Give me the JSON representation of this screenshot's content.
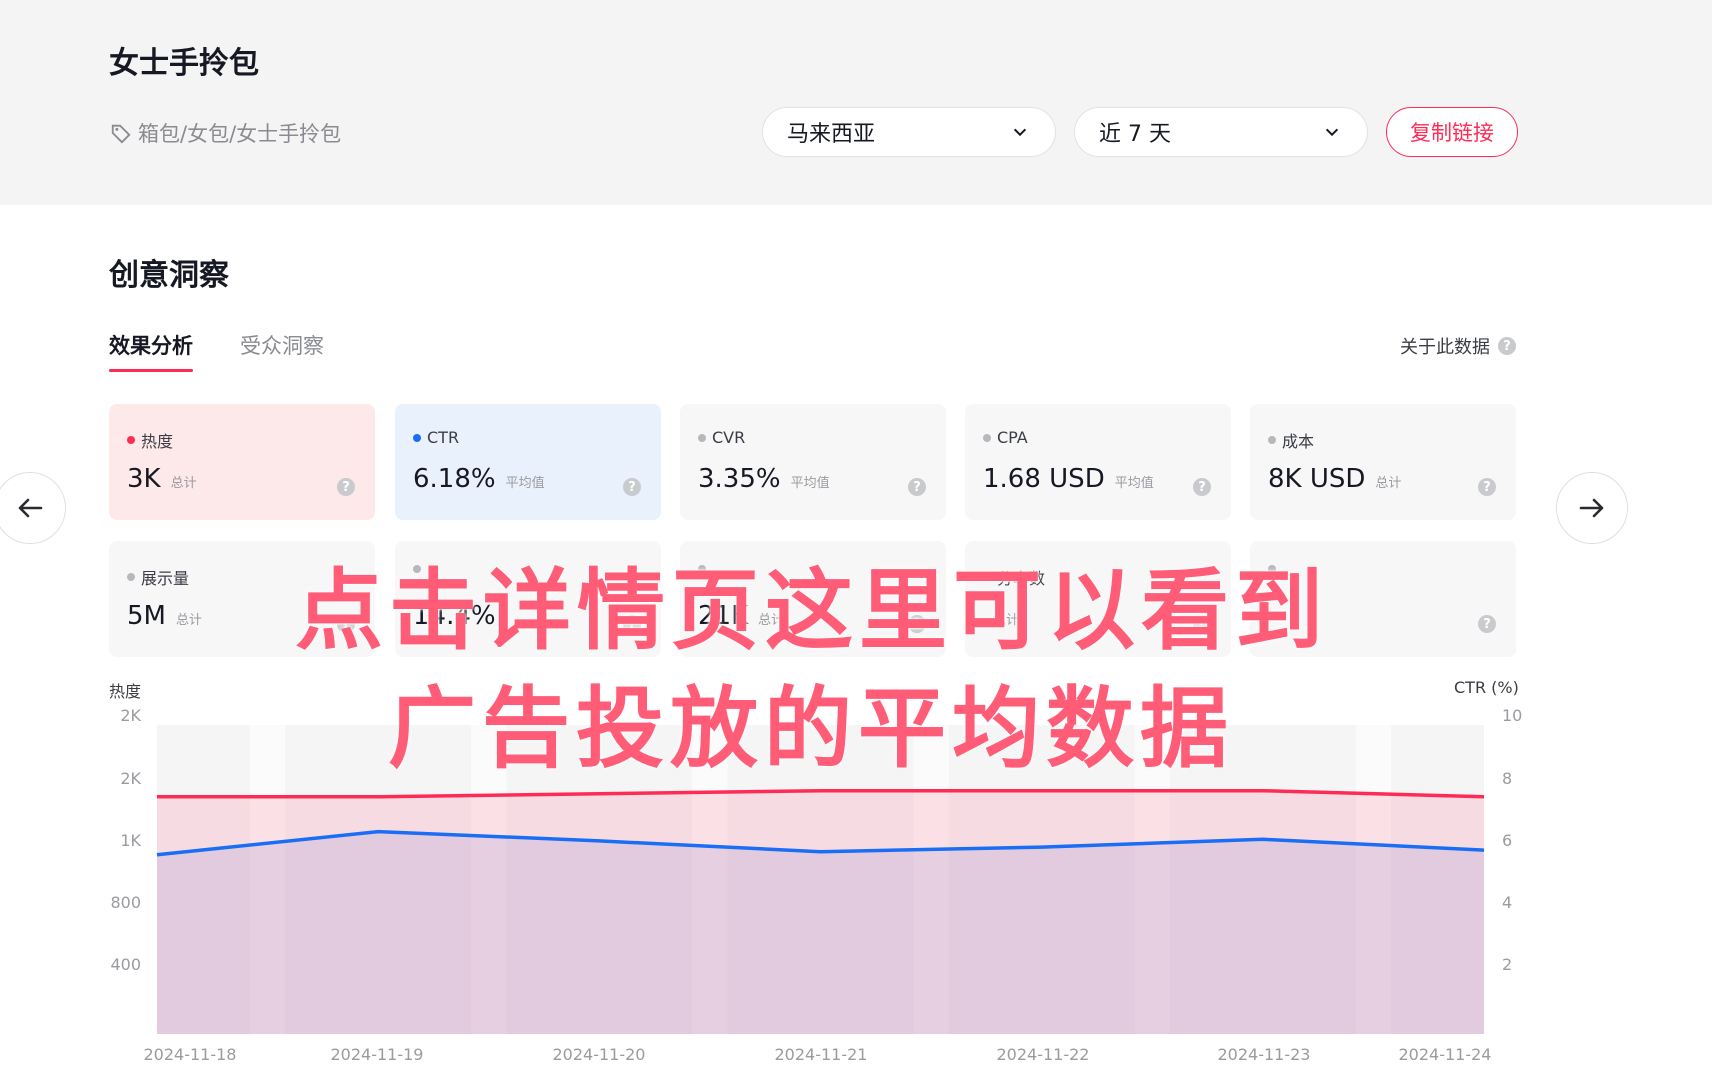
{
  "header": {
    "title": "女士手拎包",
    "breadcrumb": "箱包/女包/女士手拎包",
    "country": "马来西亚",
    "period": "近 7 天",
    "copy_link": "复制链接"
  },
  "section": {
    "title": "创意洞察",
    "tabs": [
      "效果分析",
      "受众洞察"
    ],
    "about": "关于此数据"
  },
  "metrics": [
    {
      "label": "热度",
      "value": "3K",
      "unit": "总计",
      "dot_color": "#fe2c55",
      "selected": "red"
    },
    {
      "label": "CTR",
      "value": "6.18%",
      "unit": "平均值",
      "dot_color": "#1a6ef5",
      "selected": "blue"
    },
    {
      "label": "CVR",
      "value": "3.35%",
      "unit": "平均值",
      "dot_color": "#b7b8bc",
      "selected": ""
    },
    {
      "label": "CPA",
      "value": "1.68 USD",
      "unit": "平均值",
      "dot_color": "#b7b8bc",
      "selected": ""
    },
    {
      "label": "成本",
      "value": "8K USD",
      "unit": "总计",
      "dot_color": "#b7b8bc",
      "selected": ""
    },
    {
      "label": "展示量",
      "value": "5M",
      "unit": "总计",
      "dot_color": "#b7b8bc",
      "selected": ""
    },
    {
      "label": "",
      "value": "14.4%",
      "unit": "",
      "dot_color": "#b7b8bc",
      "selected": ""
    },
    {
      "label": "",
      "value": "21K",
      "unit": "总计",
      "dot_color": "#b7b8bc",
      "selected": ""
    },
    {
      "label": "分享数",
      "value": "",
      "unit": "总计",
      "dot_color": "#b7b8bc",
      "selected": ""
    },
    {
      "label": "",
      "value": "",
      "unit": "",
      "dot_color": "#b7b8bc",
      "selected": ""
    }
  ],
  "chart_data": {
    "type": "area",
    "ylabel_left": "热度",
    "ylabel_right": "CTR (%)",
    "left_ticks": [
      "2K",
      "2K",
      "1K",
      "800",
      "400"
    ],
    "right_ticks": [
      "10",
      "8",
      "6",
      "4",
      "2"
    ],
    "x": [
      "2024-11-18",
      "2024-11-19",
      "2024-11-20",
      "2024-11-21",
      "2024-11-22",
      "2024-11-23",
      "2024-11-24"
    ],
    "series": [
      {
        "name": "热度",
        "color": "#fe2c55",
        "values": [
          1535,
          1535,
          1555,
          1575,
          1575,
          1575,
          1535
        ]
      },
      {
        "name": "CTR",
        "color": "#1a6ef5",
        "values": [
          5.8,
          6.55,
          6.25,
          5.9,
          6.05,
          6.3,
          5.95
        ]
      }
    ],
    "left_range": [
      0,
      2000
    ],
    "right_range": [
      0,
      10
    ]
  },
  "overlay": {
    "line1": "点击详情页这里可以看到",
    "line2": "广告投放的平均数据"
  },
  "nav": {
    "prev_icon": "arrow-left-icon",
    "next_icon": "arrow-right-icon"
  }
}
